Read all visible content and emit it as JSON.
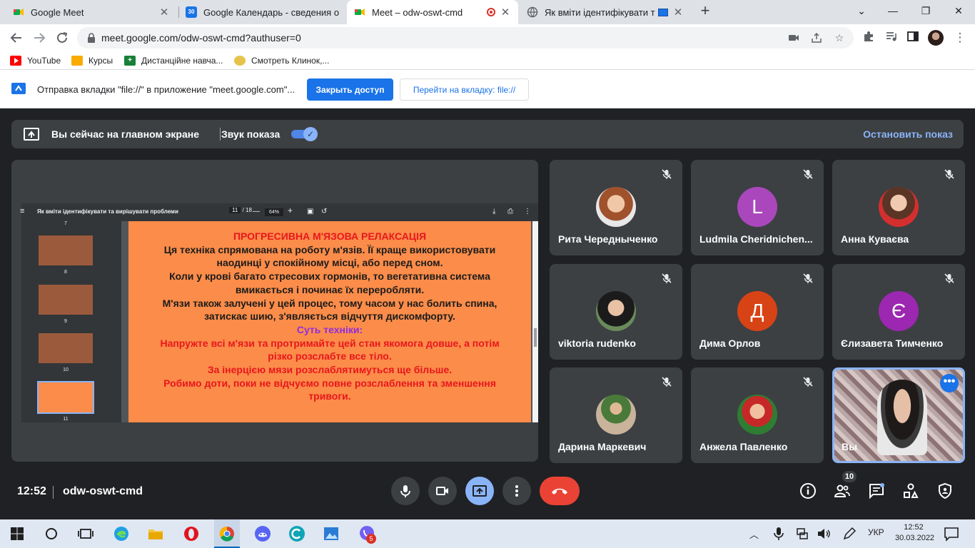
{
  "tabs": [
    {
      "title": "Google Meet",
      "fav_color": "#00ac47"
    },
    {
      "title": "Google Календарь - сведения о",
      "fav_text": "30"
    },
    {
      "title": "Meet – odw-oswt-cmd",
      "fav_color": "#00ac47"
    },
    {
      "title": "Як вміти ідентифікувати та"
    }
  ],
  "address": {
    "url": "meet.google.com/odw-oswt-cmd?authuser=0"
  },
  "bookmarks": [
    {
      "label": "YouTube"
    },
    {
      "label": "Курсы"
    },
    {
      "label": "Дистанційне навча..."
    },
    {
      "label": "Смотреть Клинок,..."
    }
  ],
  "infobar": {
    "text": "Отправка вкладки \"file://\" в приложение \"meet.google.com\"...",
    "primary": "Закрыть доступ",
    "secondary": "Перейти на вкладку: file://"
  },
  "present_bar": {
    "status": "Вы сейчас на главном экране",
    "sound": "Звук показа",
    "stop": "Остановить показ"
  },
  "pdf": {
    "title": "Як вміти ідентифікувати та вирішувати проблеми",
    "page": "11",
    "total": "/ 18",
    "zoom": "64%",
    "thumbs": [
      "7",
      "8",
      "9",
      "10",
      "11"
    ]
  },
  "slide": {
    "heading": "ПРОГРЕСИВНА М'ЯЗОВА РЕЛАКСАЦІЯ",
    "lines": [
      "Ця техніка спрямована на роботу м'язів. Її краще використовувати",
      "наодинці у спокійному місці, або перед сном.",
      "Коли у крові багато стресових гормонів, то вегетативна система",
      "вмикається і починає їх переробляти.",
      "М'язи також залучені у цей процес, тому часом у нас болить спина,",
      "затискає шию, з'являється відчуття дискомфорту."
    ],
    "subheading": "Суть техніки:",
    "red_lines": [
      "Напружте всі м'язи та протримайте цей стан якомога довше, а потім",
      "різко розслабте все тіло.",
      "За інерцією мязи розслаблятимуться ще більше.",
      "Робимо доти, поки не відчуємо повне розслаблення та зменшення",
      "тривоги."
    ]
  },
  "participants": [
    {
      "name": "Рита Чередныченко"
    },
    {
      "name": "Ludmila Cheridnichen...",
      "initial": "L",
      "color": "#ab47bc"
    },
    {
      "name": "Анна Куваєва"
    },
    {
      "name": "viktoria rudenko"
    },
    {
      "name": "Дима Орлов",
      "initial": "Д",
      "color": "#d84315"
    },
    {
      "name": "Єлизавета Тимченко",
      "initial": "Є",
      "color": "#9c27b0"
    },
    {
      "name": "Дарина Маркевич"
    },
    {
      "name": "Анжела Павленко"
    },
    {
      "name": "Вы"
    }
  ],
  "bottom": {
    "time": "12:52",
    "code": "odw-oswt-cmd",
    "people_count": "10"
  },
  "taskbar": {
    "lang": "УКР",
    "time": "12:52",
    "date": "30.03.2022",
    "viber_badge": "5"
  },
  "colors": {
    "meet_bg": "#202124",
    "tile_bg": "#3c4043",
    "accent": "#8ab4f8",
    "hangup": "#ea4335",
    "slide_bg": "#fb8c49"
  }
}
